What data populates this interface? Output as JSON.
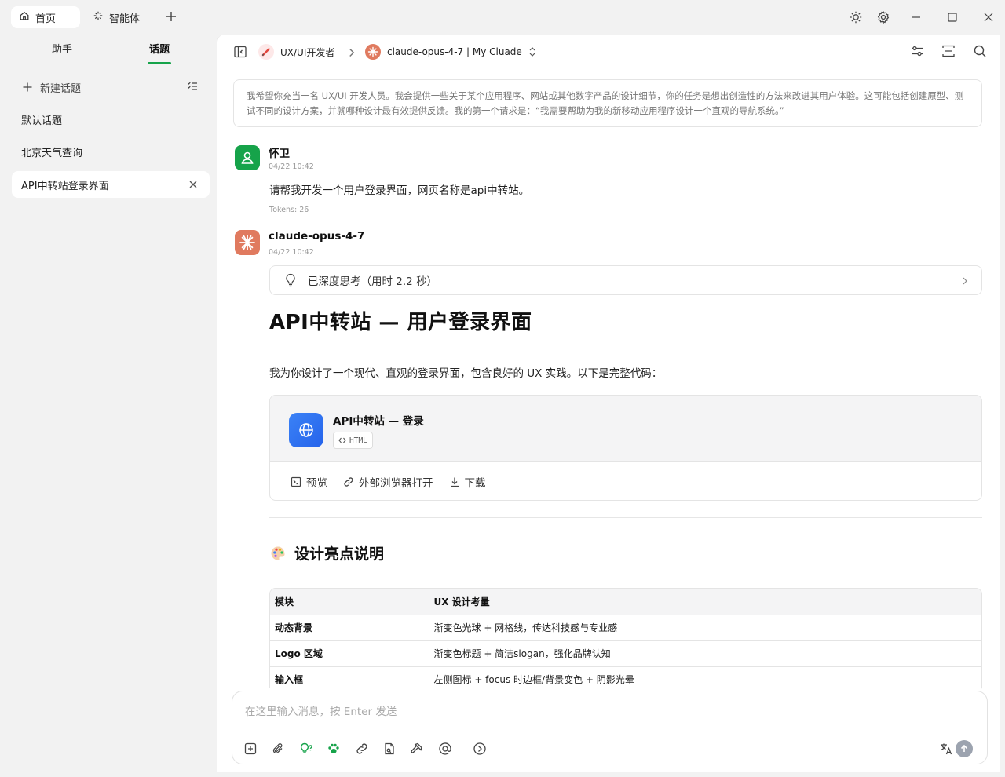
{
  "titlebar": {
    "tabs": [
      {
        "label": "首页",
        "icon": "home-icon"
      },
      {
        "label": "智能体",
        "icon": "sparkle-icon"
      }
    ]
  },
  "sidebar": {
    "tabs": [
      "助手",
      "话题"
    ],
    "active_tab": "话题",
    "new_topic": "新建话题",
    "topics": [
      "默认话题",
      "北京天气查询",
      "API中转站登录界面"
    ],
    "active_topic": "API中转站登录界面"
  },
  "header": {
    "assistant": "UX/UI开发者",
    "model": "claude-opus-4-7 | My Cluade"
  },
  "prompt": "我希望你充当一名 UX/UI 开发人员。我会提供一些关于某个应用程序、网站或其他数字产品的设计细节，你的任务是想出创造性的方法来改进其用户体验。这可能包括创建原型、测试不同的设计方案，并就哪种设计最有效提供反馈。我的第一个请求是：“我需要帮助为我的新移动应用程序设计一个直观的导航系统。”",
  "user_message": {
    "name": "怀卫",
    "time": "04/22 10:42",
    "text": "请帮我开发一个用户登录界面，网页名称是api中转站。",
    "tokens": "Tokens: 26"
  },
  "assistant_message": {
    "name": "claude-opus-4-7",
    "time": "04/22 10:42",
    "thinking": "已深度思考（用时 2.2 秒）",
    "heading": "API中转站 — 用户登录界面",
    "intro": "我为你设计了一个现代、直观的登录界面，包含良好的 UX 实践。以下是完整代码：",
    "artifact": {
      "title": "API中转站 — 登录",
      "badge": "HTML",
      "actions": [
        "预览",
        "外部浏览器打开",
        "下载"
      ]
    },
    "section_title": "设计亮点说明",
    "table": {
      "headers": [
        "模块",
        "UX 设计考量"
      ],
      "rows": [
        [
          "动态背景",
          "渐变色光球 + 网格线，传达科技感与专业感"
        ],
        [
          "Logo 区域",
          "渐变色标题 + 简洁slogan，强化品牌认知"
        ],
        [
          "输入框",
          "左侧图标 + focus 时边框/背景变色 + 阴影光晕"
        ]
      ]
    }
  },
  "input": {
    "placeholder": "在这里输入消息，按 Enter 发送"
  },
  "colors": {
    "accent_green": "#16a34a",
    "user_avatar": "#16a34a",
    "assistant_avatar": "#e07a5f",
    "artifact_icon": "#2563eb"
  }
}
